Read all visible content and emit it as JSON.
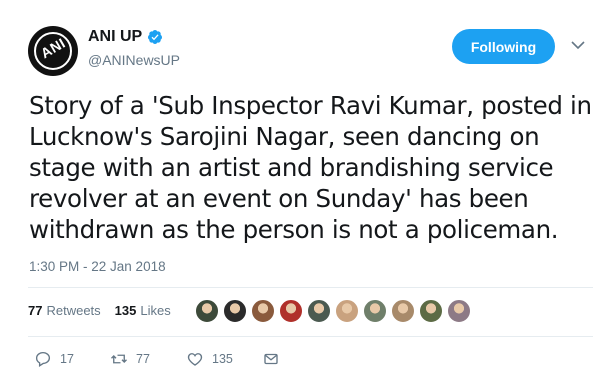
{
  "account": {
    "display_name": "ANI UP",
    "handle": "@ANINewsUP",
    "avatar_text": "ANI",
    "verified": true
  },
  "follow_button": {
    "label": "Following",
    "color": "#1da1f2"
  },
  "tweet": {
    "text": "Story of a 'Sub Inspector Ravi Kumar, posted in Lucknow's Sarojini Nagar, seen dancing on stage with an artist and brandishing service revolver at an event on Sunday' has been withdrawn as the person is not a policeman.",
    "timestamp": "1:30 PM - 22 Jan 2018"
  },
  "stats": {
    "retweets_count": "77",
    "retweets_label": "Retweets",
    "likes_count": "135",
    "likes_label": "Likes"
  },
  "liker_avatars": [
    "#3d4a3a",
    "#2b2b2b",
    "#8a5a3c",
    "#b0302a",
    "#4b5a50",
    "#c9a27f",
    "#6f7f6a",
    "#a88a6a",
    "#5c6b45",
    "#8d7a86"
  ],
  "actions": {
    "reply_count": "17",
    "retweet_count": "77",
    "like_count": "135"
  },
  "icons": {
    "verified": "verified-badge-icon",
    "chevron": "chevron-down-icon",
    "reply": "reply-icon",
    "retweet": "retweet-icon",
    "like": "heart-icon",
    "message": "envelope-icon"
  }
}
